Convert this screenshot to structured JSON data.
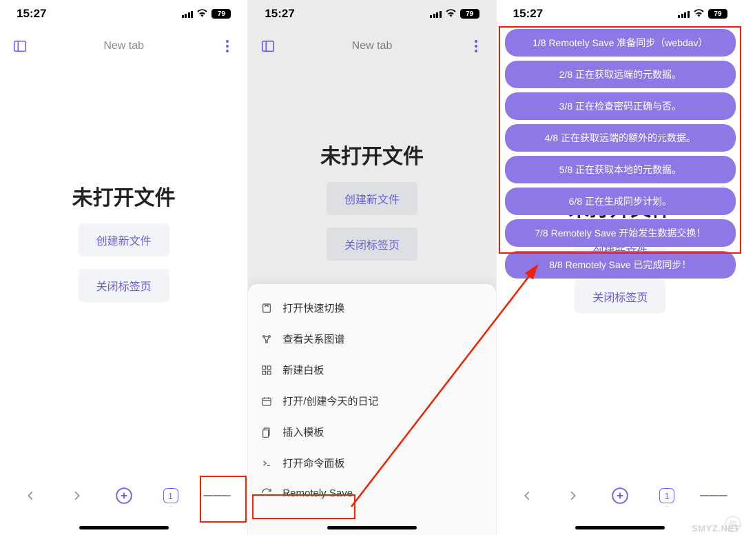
{
  "status": {
    "time": "15:27",
    "battery": "79"
  },
  "topbar": {
    "tab_label": "New tab"
  },
  "empty": {
    "title": "未打开文件",
    "create_label": "创建新文件",
    "close_tab_label": "关闭标签页"
  },
  "bottom": {
    "tab_count": "1"
  },
  "sheet": {
    "items": [
      {
        "label": "打开快速切换"
      },
      {
        "label": "查看关系图谱"
      },
      {
        "label": "新建白板"
      },
      {
        "label": "打开/创建今天的日记"
      },
      {
        "label": "插入模板"
      },
      {
        "label": "打开命令面板"
      },
      {
        "label": "Remotely Save"
      }
    ]
  },
  "toasts": [
    "1/8 Remotely Save 准备同步（webdav）",
    "2/8 正在获取远端的元数据。",
    "3/8 正在检查密码正确与否。",
    "4/8 正在获取远端的额外的元数据。",
    "5/8 正在获取本地的元数据。",
    "6/8 正在生成同步计划。",
    "7/8 Remotely Save 开始发生数据交换！",
    "8/8 Remotely Save 已完成同步！"
  ],
  "watermark": {
    "text1": "值",
    "text2": "SMYZ.NET"
  }
}
